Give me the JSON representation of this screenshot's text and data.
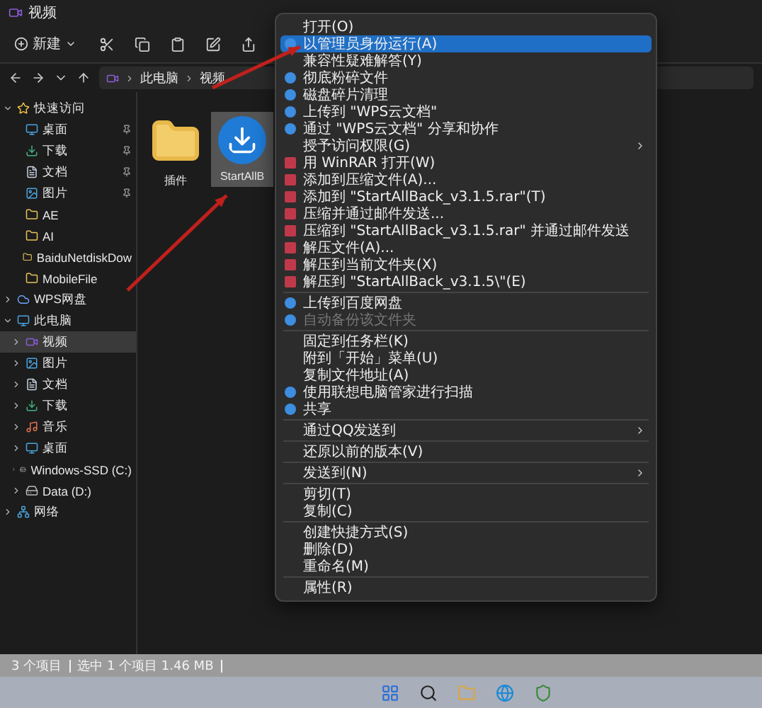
{
  "window": {
    "title": "视频"
  },
  "toolbar": {
    "new_label": "新建"
  },
  "address": {
    "crumbs": [
      "此电脑",
      "视频"
    ]
  },
  "sidebar": {
    "items": [
      {
        "label": "快速访问",
        "kind": "star",
        "expanded": true,
        "selected": false,
        "children": [
          {
            "label": "桌面",
            "kind": "desktop",
            "pinned": true,
            "selected": false
          },
          {
            "label": "下载",
            "kind": "download",
            "pinned": true,
            "selected": false
          },
          {
            "label": "文档",
            "kind": "doc",
            "pinned": true,
            "selected": false
          },
          {
            "label": "图片",
            "kind": "picture",
            "pinned": true,
            "selected": false
          },
          {
            "label": "AE",
            "kind": "folder",
            "pinned": false,
            "selected": false
          },
          {
            "label": "AI",
            "kind": "folder",
            "pinned": false,
            "selected": false
          },
          {
            "label": "BaiduNetdiskDow",
            "kind": "folder",
            "pinned": false,
            "selected": false
          },
          {
            "label": "MobileFile",
            "kind": "folder",
            "pinned": false,
            "selected": false
          }
        ]
      },
      {
        "label": "WPS网盘",
        "kind": "cloud",
        "expanded": false,
        "selected": false
      },
      {
        "label": "此电脑",
        "kind": "pc",
        "expanded": true,
        "selected": false,
        "children": [
          {
            "label": "视频",
            "kind": "video",
            "expanded": false,
            "selected": true
          },
          {
            "label": "图片",
            "kind": "picture",
            "expanded": false,
            "selected": false
          },
          {
            "label": "文档",
            "kind": "doc",
            "expanded": false,
            "selected": false
          },
          {
            "label": "下载",
            "kind": "download",
            "expanded": false,
            "selected": false
          },
          {
            "label": "音乐",
            "kind": "music",
            "expanded": false,
            "selected": false
          },
          {
            "label": "桌面",
            "kind": "desktop",
            "expanded": false,
            "selected": false
          },
          {
            "label": "Windows-SSD (C:)",
            "kind": "drive",
            "expanded": false,
            "selected": false
          },
          {
            "label": "Data (D:)",
            "kind": "drive",
            "expanded": false,
            "selected": false
          }
        ]
      },
      {
        "label": "网络",
        "kind": "network",
        "expanded": false,
        "selected": false
      }
    ]
  },
  "files": [
    {
      "name": "插件",
      "kind": "folder",
      "selected": false
    },
    {
      "name": "StartAllB",
      "kind": "installer",
      "selected": true
    }
  ],
  "context_menu": {
    "groups": [
      [
        {
          "label": "打开(O)",
          "kind": "plain",
          "selected": false,
          "submenu": false,
          "disabled": false
        },
        {
          "label": "以管理员身份运行(A)",
          "kind": "icon",
          "selected": true,
          "submenu": false,
          "disabled": false
        },
        {
          "label": "兼容性疑难解答(Y)",
          "kind": "plain",
          "selected": false,
          "submenu": false,
          "disabled": false
        },
        {
          "label": "彻底粉碎文件",
          "kind": "icon",
          "selected": false,
          "submenu": false,
          "disabled": false
        },
        {
          "label": "磁盘碎片清理",
          "kind": "icon",
          "selected": false,
          "submenu": false,
          "disabled": false
        },
        {
          "label": "上传到 \"WPS云文档\"",
          "kind": "icon",
          "selected": false,
          "submenu": false,
          "disabled": false
        },
        {
          "label": "通过 \"WPS云文档\" 分享和协作",
          "kind": "icon",
          "selected": false,
          "submenu": false,
          "disabled": false
        },
        {
          "label": "授予访问权限(G)",
          "kind": "plain",
          "selected": false,
          "submenu": true,
          "disabled": false
        },
        {
          "label": "用 WinRAR 打开(W)",
          "kind": "archive",
          "selected": false,
          "submenu": false,
          "disabled": false
        },
        {
          "label": "添加到压缩文件(A)...",
          "kind": "archive",
          "selected": false,
          "submenu": false,
          "disabled": false
        },
        {
          "label": "添加到 \"StartAllBack_v3.1.5.rar\"(T)",
          "kind": "archive",
          "selected": false,
          "submenu": false,
          "disabled": false
        },
        {
          "label": "压缩并通过邮件发送...",
          "kind": "archive",
          "selected": false,
          "submenu": false,
          "disabled": false
        },
        {
          "label": "压缩到 \"StartAllBack_v3.1.5.rar\" 并通过邮件发送",
          "kind": "archive",
          "selected": false,
          "submenu": false,
          "disabled": false
        },
        {
          "label": "解压文件(A)...",
          "kind": "archive",
          "selected": false,
          "submenu": false,
          "disabled": false
        },
        {
          "label": "解压到当前文件夹(X)",
          "kind": "archive",
          "selected": false,
          "submenu": false,
          "disabled": false
        },
        {
          "label": "解压到 \"StartAllBack_v3.1.5\\\"(E)",
          "kind": "archive",
          "selected": false,
          "submenu": false,
          "disabled": false
        }
      ],
      [
        {
          "label": "上传到百度网盘",
          "kind": "icon",
          "selected": false,
          "submenu": false,
          "disabled": false
        },
        {
          "label": "自动备份该文件夹",
          "kind": "icon",
          "selected": false,
          "submenu": false,
          "disabled": true
        }
      ],
      [
        {
          "label": "固定到任务栏(K)",
          "kind": "plain",
          "selected": false,
          "submenu": false,
          "disabled": false
        },
        {
          "label": "附到「开始」菜单(U)",
          "kind": "plain",
          "selected": false,
          "submenu": false,
          "disabled": false
        },
        {
          "label": "复制文件地址(A)",
          "kind": "plain",
          "selected": false,
          "submenu": false,
          "disabled": false
        },
        {
          "label": "使用联想电脑管家进行扫描",
          "kind": "icon",
          "selected": false,
          "submenu": false,
          "disabled": false
        },
        {
          "label": "共享",
          "kind": "icon",
          "selected": false,
          "submenu": false,
          "disabled": false
        }
      ],
      [
        {
          "label": "通过QQ发送到",
          "kind": "plain",
          "selected": false,
          "submenu": true,
          "disabled": false
        }
      ],
      [
        {
          "label": "还原以前的版本(V)",
          "kind": "plain",
          "selected": false,
          "submenu": false,
          "disabled": false
        }
      ],
      [
        {
          "label": "发送到(N)",
          "kind": "plain",
          "selected": false,
          "submenu": true,
          "disabled": false
        }
      ],
      [
        {
          "label": "剪切(T)",
          "kind": "plain",
          "selected": false,
          "submenu": false,
          "disabled": false
        },
        {
          "label": "复制(C)",
          "kind": "plain",
          "selected": false,
          "submenu": false,
          "disabled": false
        }
      ],
      [
        {
          "label": "创建快捷方式(S)",
          "kind": "plain",
          "selected": false,
          "submenu": false,
          "disabled": false
        },
        {
          "label": "删除(D)",
          "kind": "plain",
          "selected": false,
          "submenu": false,
          "disabled": false
        },
        {
          "label": "重命名(M)",
          "kind": "plain",
          "selected": false,
          "submenu": false,
          "disabled": false
        }
      ],
      [
        {
          "label": "属性(R)",
          "kind": "plain",
          "selected": false,
          "submenu": false,
          "disabled": false
        }
      ]
    ]
  },
  "status_bar": {
    "items": [
      "3 个项目",
      "选中 1 个项目 1.46 MB"
    ]
  }
}
